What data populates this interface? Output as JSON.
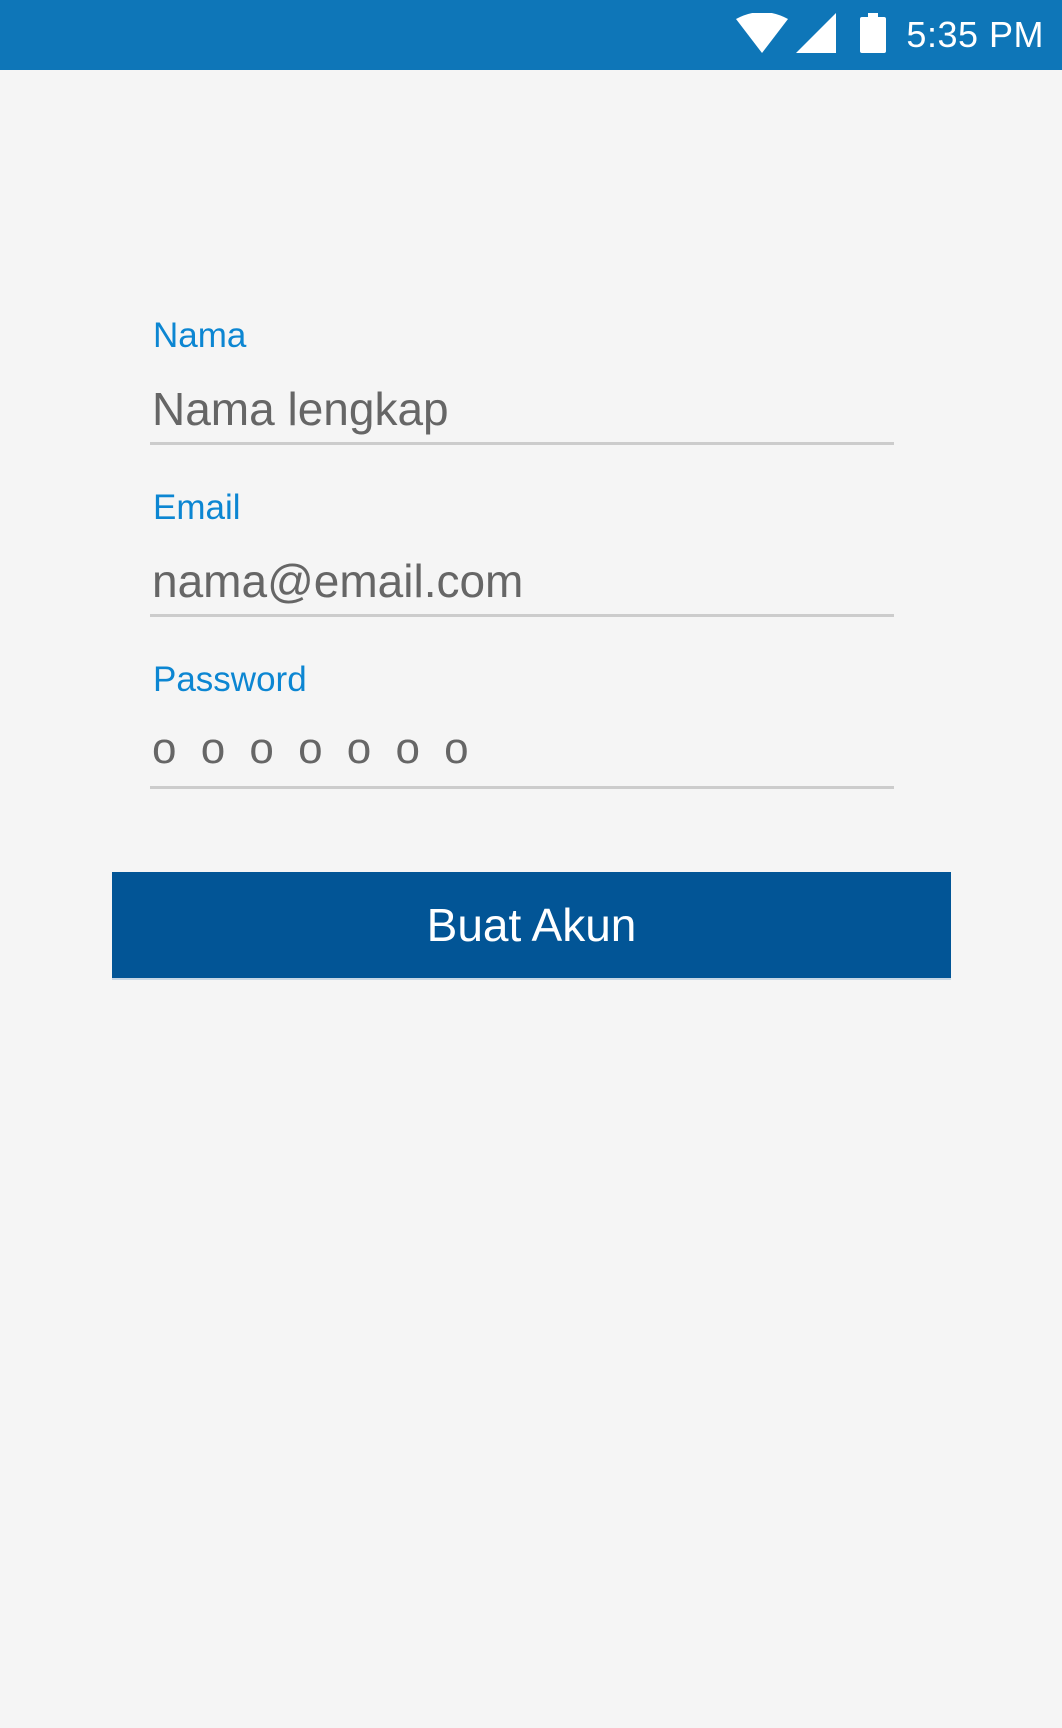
{
  "status_bar": {
    "time": "5:35 PM",
    "icons": [
      "wifi-icon",
      "signal-icon",
      "battery-icon"
    ],
    "color": "#0e76b8"
  },
  "form": {
    "name": {
      "label": "Nama",
      "placeholder": "Nama lengkap",
      "value": ""
    },
    "email": {
      "label": "Email",
      "placeholder": "nama@email.com",
      "value": ""
    },
    "password": {
      "label": "Password",
      "masked_value": "o o o o o o o"
    }
  },
  "submit_button": {
    "label": "Buat Akun",
    "color": "#025596"
  },
  "colors": {
    "label": "#0c86d2",
    "input_text": "#666666",
    "underline": "#cccccc",
    "background": "#f5f5f5"
  }
}
